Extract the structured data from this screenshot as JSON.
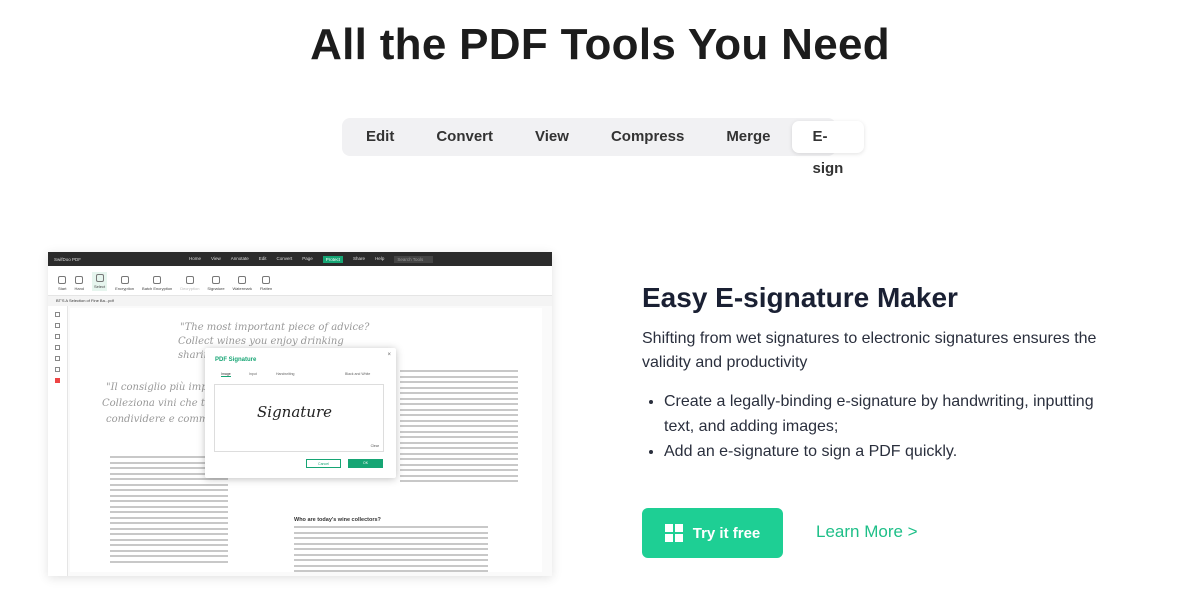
{
  "page_title": "All the PDF Tools You Need",
  "tabs": [
    {
      "label": "Edit"
    },
    {
      "label": "Convert"
    },
    {
      "label": "View"
    },
    {
      "label": "Compress"
    },
    {
      "label": "Merge"
    },
    {
      "label": "E-sign",
      "active": true
    }
  ],
  "app": {
    "name": "SwifDoo PDF",
    "menu": [
      "Home",
      "View",
      "Annotate",
      "Edit",
      "Convert",
      "Page",
      "Protect",
      "Share",
      "Help"
    ],
    "search_placeholder": "Search Tools",
    "ribbon": [
      "Start",
      "Hand",
      "Select",
      "Encryption",
      "Batch Encryption",
      "Decryption",
      "Signature",
      "Watermark",
      "Flatten"
    ],
    "doc_tab": "BT'S A Selection of Fine Ba...pdf",
    "doc_heading": "Who are today's wine collectors?",
    "dialog": {
      "title": "PDF Signature",
      "tabs": [
        "Image",
        "Input",
        "Handwriting"
      ],
      "toggle_label": "Black and White",
      "signature": "Signature",
      "clear": "Clear",
      "cancel": "Cancel",
      "ok": "OK"
    }
  },
  "feature": {
    "title": "Easy E-signature Maker",
    "description": "Shifting from wet signatures to electronic signatures ensures the validity and productivity",
    "bullets": [
      "Create a legally-binding e-signature by handwriting, inputting text, and adding images;",
      "Add an e-signature to sign a PDF quickly."
    ],
    "try_label": "Try it free",
    "learn_label": "Learn More >"
  },
  "colors": {
    "accent": "#1ecf94",
    "app_accent": "#16a574"
  }
}
